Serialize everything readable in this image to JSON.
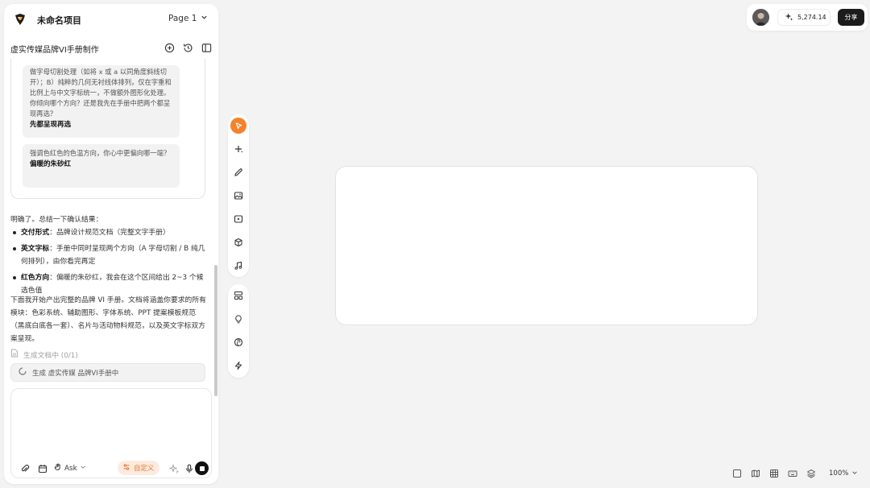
{
  "app": {
    "project_name": "未命名项目",
    "page_selector": "Page 1",
    "document_title": "虚实传媒品牌VI手册制作"
  },
  "chat": {
    "qa": [
      {
        "question": "做字母切割处理（如将 x 或 a 以同角度斜线切开）；B）纯粹的几何无衬线体排列，仅在字重和比例上与中文字标统一，不做额外图形化处理。你倾向哪个方向？还是我先在手册中把两个都呈现再选？",
        "answer": "先都呈现再选"
      },
      {
        "question": "强调色红色的色温方向，你心中更偏向哪一端？",
        "answer": "偏暖的朱砂红"
      }
    ],
    "summary_intro": "明确了。总结一下确认结果：",
    "bullets": [
      {
        "label": "交付形式",
        "text": "：品牌设计规范文档（完整文字手册）"
      },
      {
        "label": "英文字标",
        "text": "：手册中同时呈现两个方向（A 字母切割 / B 纯几何排列），由你看完再定"
      },
      {
        "label": "红色方向",
        "text": "：偏暖的朱砂红，我会在这个区间给出 2~3 个候选色值"
      }
    ],
    "plan_text": "下面我开始产出完整的品牌 VI 手册。文档将涵盖你要求的所有模块：色彩系统、辅助图形、字体系统、PPT 提案模板规范（黑底白底各一套）、名片与活动物料规范，以及英文字标双方案呈现。",
    "gen_status": "生成文档中 (0/1)",
    "gen_task": "生成 虚实传媒 品牌VI手册中"
  },
  "input": {
    "placeholder": "",
    "mode_label": "Ask",
    "custom_label": "自定义"
  },
  "header_right": {
    "credits": "5,274.14",
    "share_label": "分享"
  },
  "footer": {
    "zoom": "100%"
  },
  "colors": {
    "accent": "#f4822a",
    "custom_chip_bg": "#fdebdf",
    "custom_chip_text": "#e8783a"
  }
}
